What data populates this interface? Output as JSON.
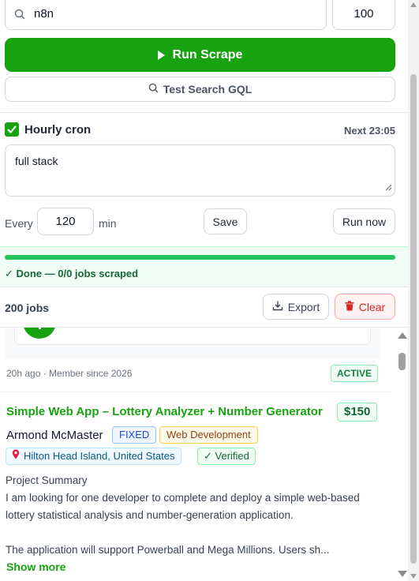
{
  "search": {
    "query": "n8n",
    "limit": "100"
  },
  "actions": {
    "run_scrape": "Run Scrape",
    "test_gql": "Test Search GQL"
  },
  "cron": {
    "label": "Hourly cron",
    "checked": true,
    "next": "Next 23:05",
    "query": "full stack",
    "every_label": "Every",
    "interval": "120",
    "unit": "min",
    "save": "Save",
    "run_now": "Run now"
  },
  "status": {
    "progress_fraction": 1.0,
    "text": "✓ Done — 0/0 jobs scraped"
  },
  "jobs_bar": {
    "count": "200 jobs",
    "export": "Export",
    "clear": "Clear"
  },
  "previous_job": {
    "meta": "20h ago · Member since 2026",
    "status": "ACTIVE"
  },
  "job": {
    "title": "Simple Web App – Lottery Analyzer + Number Generator",
    "price": "$150",
    "client": "Armond McMaster",
    "type": "FIXED",
    "category": "Web Development",
    "location": "Hilton Head Island, United States",
    "verified": "✓ Verified",
    "description": "Project Summary\nI am looking for one developer to complete and deploy a simple web-based lottery statistical analysis and number-generation application.\n\nThe application will support Powerball and Mega Millions. Users sh...",
    "show_more": "Show more"
  },
  "colors": {
    "accent": "#16a30f",
    "danger": "#dc2626",
    "success_bg": "#f0fdf4"
  },
  "icons": [
    "search-icon",
    "play-icon",
    "check-icon",
    "export-icon",
    "trash-icon",
    "location-pin-icon"
  ]
}
